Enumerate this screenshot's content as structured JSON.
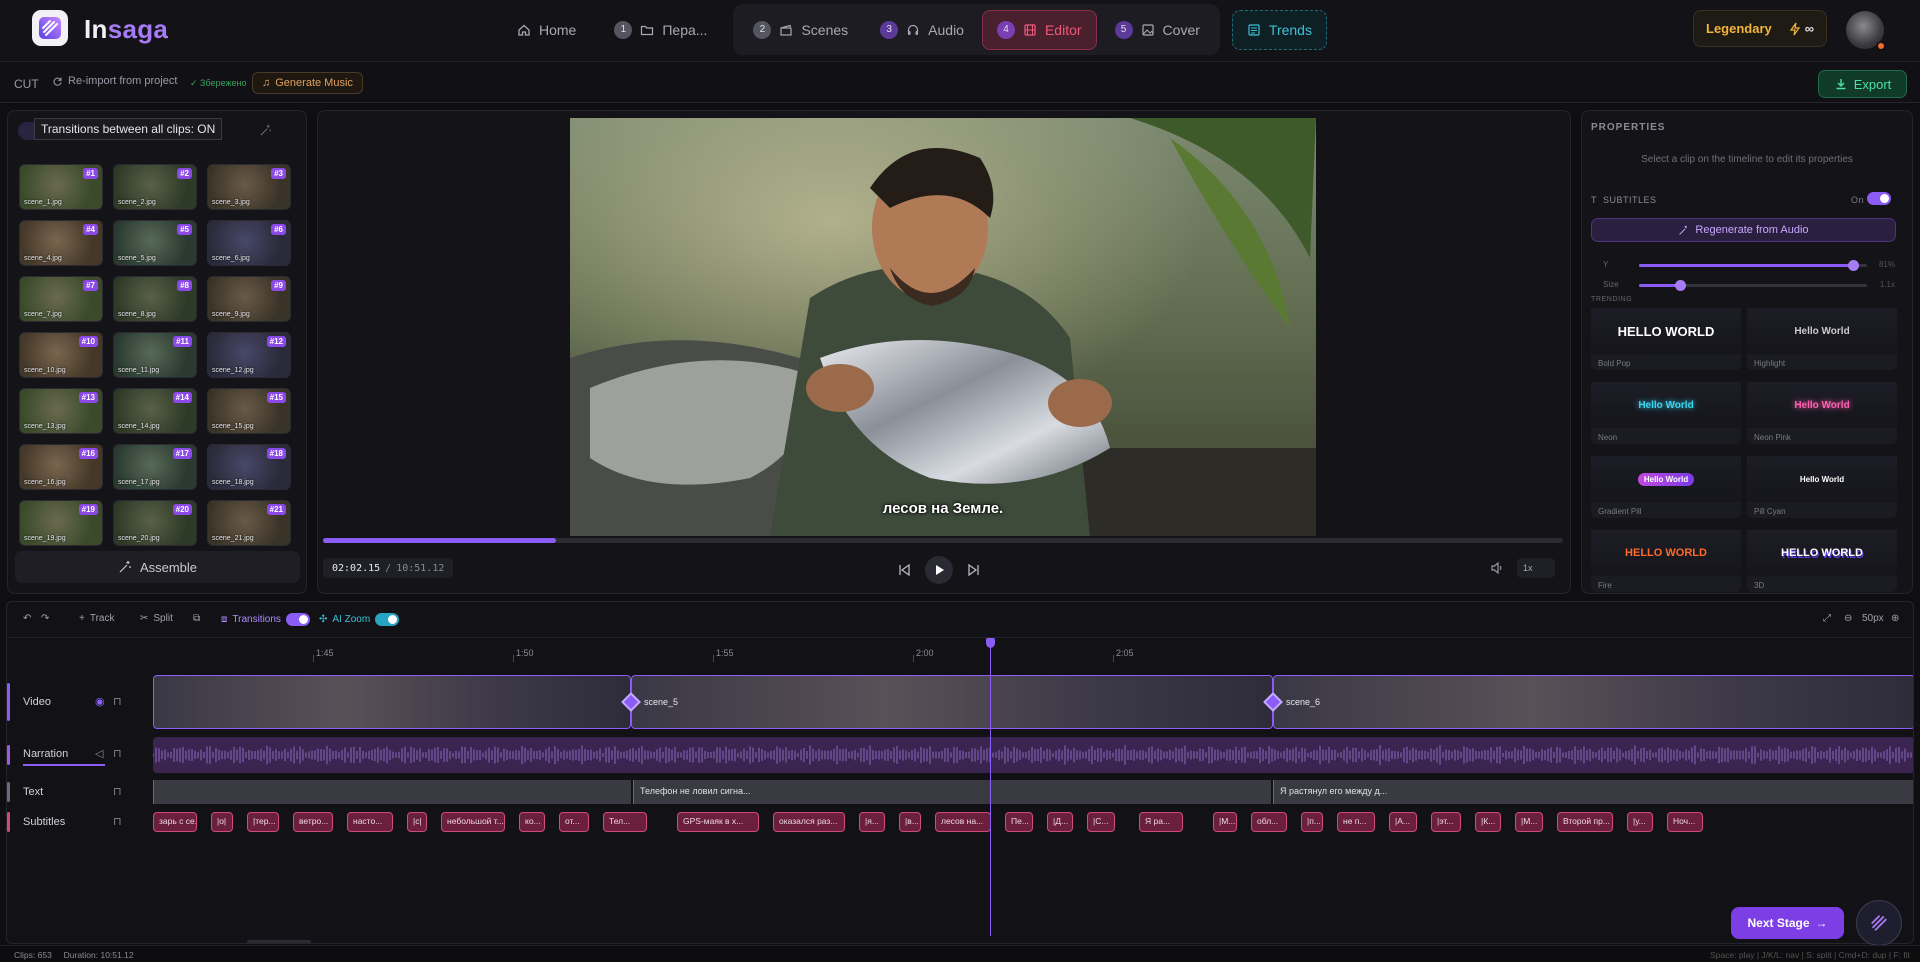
{
  "app": {
    "brand_a": "In",
    "brand_b": "saga"
  },
  "nav": {
    "home": "Home",
    "steps": [
      {
        "num": "1",
        "label": "Пера..."
      },
      {
        "num": "2",
        "label": "Scenes"
      },
      {
        "num": "3",
        "label": "Audio"
      },
      {
        "num": "4",
        "label": "Editor"
      },
      {
        "num": "5",
        "label": "Cover"
      }
    ],
    "trends": "Trends"
  },
  "tier": {
    "label": "Legendary",
    "credits": "∞"
  },
  "subbar": {
    "mode": "CUT",
    "reimport": "Re-import from project",
    "saved": "✓ Збережено",
    "generate_music": "Generate Music",
    "export": "Export"
  },
  "left": {
    "tooltip": "Transitions between all clips: ON",
    "assemble": "Assemble",
    "scenes": [
      {
        "badge": "#1",
        "name": "scene_1.jpg"
      },
      {
        "badge": "#2",
        "name": "scene_2.jpg"
      },
      {
        "badge": "#3",
        "name": "scene_3.jpg"
      },
      {
        "badge": "#4",
        "name": "scene_4.jpg"
      },
      {
        "badge": "#5",
        "name": "scene_5.jpg"
      },
      {
        "badge": "#6",
        "name": "scene_6.jpg"
      },
      {
        "badge": "#7",
        "name": "scene_7.jpg"
      },
      {
        "badge": "#8",
        "name": "scene_8.jpg"
      },
      {
        "badge": "#9",
        "name": "scene_9.jpg"
      },
      {
        "badge": "#10",
        "name": "scene_10.jpg"
      },
      {
        "badge": "#11",
        "name": "scene_11.jpg"
      },
      {
        "badge": "#12",
        "name": "scene_12.jpg"
      },
      {
        "badge": "#13",
        "name": "scene_13.jpg"
      },
      {
        "badge": "#14",
        "name": "scene_14.jpg"
      },
      {
        "badge": "#15",
        "name": "scene_15.jpg"
      },
      {
        "badge": "#16",
        "name": "scene_16.jpg"
      },
      {
        "badge": "#17",
        "name": "scene_17.jpg"
      },
      {
        "badge": "#18",
        "name": "scene_18.jpg"
      },
      {
        "badge": "#19",
        "name": "scene_19.jpg"
      },
      {
        "badge": "#20",
        "name": "scene_20.jpg"
      },
      {
        "badge": "#21",
        "name": "scene_21.jpg"
      }
    ]
  },
  "preview": {
    "caption": "лесов на Земле.",
    "time_current": "02:02.15",
    "time_sep": "/",
    "time_total": "10:51.12",
    "progress_fraction": 0.188,
    "speed": "1x"
  },
  "properties": {
    "title": "PROPERTIES",
    "hint": "Select a clip on the timeline to edit its properties",
    "subtitles_label": "SUBTITLES",
    "on_label": "On",
    "regenerate": "Regenerate from Audio",
    "y_label": "Y",
    "y_value": "81%",
    "y_fraction": 0.94,
    "size_label": "Size",
    "size_value": "1.1x",
    "size_fraction": 0.18,
    "trending": "TRENDING",
    "styles": [
      {
        "preview": "HELLO WORLD",
        "name": "Bold Pop"
      },
      {
        "preview": "Hello World",
        "name": "Highlight"
      },
      {
        "preview": "Hello World",
        "name": "Neon"
      },
      {
        "preview": "Hello World",
        "name": "Neon Pink"
      },
      {
        "preview": "Hello World",
        "name": "Gradient Pill"
      },
      {
        "preview": "Hello World",
        "name": "Pill Cyan"
      },
      {
        "preview": "HELLO WORLD",
        "name": "Fire"
      },
      {
        "preview": "HELLO WORLD",
        "name": "3D"
      }
    ]
  },
  "timeline": {
    "track_btn": "Track",
    "split_btn": "Split",
    "transitions": "Transitions",
    "ai_zoom": "AI Zoom",
    "zoom": "50px",
    "ruler": [
      "1:45",
      "1:50",
      "1:55",
      "2:00",
      "2:05"
    ],
    "tracks": {
      "video": "Video",
      "narration": "Narration",
      "text": "Text",
      "subtitles": "Subtitles"
    },
    "video_clips": [
      "scene_5",
      "scene_6"
    ],
    "text_clips": [
      "Телефон не ловил сигна...",
      "Я растянул его между д..."
    ],
    "subtitle_clips": [
      "зарь с се...",
      "|о|",
      "|тер...",
      "ветро...",
      "насто...",
      "|с|",
      "небольшой т...",
      "ко...",
      "от...",
      "Тел...",
      "GPS-маяк в х...",
      "оказался раз...",
      "|я...",
      "|в...",
      "лесов на...",
      "Пе...",
      "|Д...",
      "|С...",
      "Я ра...",
      "|М...",
      "обл...",
      "|п...",
      "не п...",
      "|А...",
      "|эт...",
      "|К...",
      "|М...",
      "Второй пр...",
      "|у...",
      "Ноч..."
    ]
  },
  "next_stage": "Next Stage",
  "status": {
    "clips": "Clips: 653",
    "duration": "Duration: 10:51.12",
    "shortcuts": "Space: play | J/K/L: nav | S: split | Cmd+D: dup | F: fit"
  }
}
